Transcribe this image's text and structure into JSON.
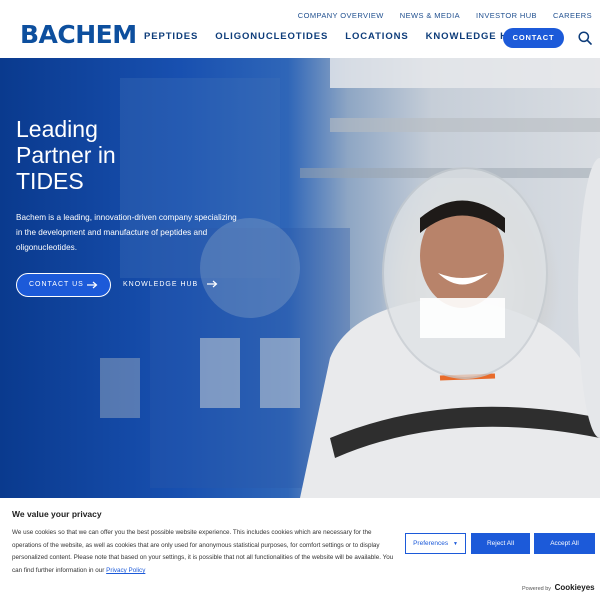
{
  "header": {
    "logo": "BACHEM",
    "top_links": [
      "COMPANY OVERVIEW",
      "NEWS & MEDIA",
      "INVESTOR HUB",
      "CAREERS"
    ],
    "main_nav": [
      "PEPTIDES",
      "OLIGONUCLEOTIDES",
      "LOCATIONS",
      "KNOWLEDGE HUB"
    ],
    "contact_label": "CONTACT"
  },
  "hero": {
    "title_line1": "Leading",
    "title_line2": "Partner in",
    "title_line3": "TIDES",
    "description": "Bachem is a leading, innovation-driven company specializing in the development and manufacture of peptides and oligonucleotides.",
    "contact_button": "CONTACT US",
    "knowledge_link": "KNOWLEDGE HUB"
  },
  "cookie": {
    "title": "We value your privacy",
    "text": "We use cookies so that we can offer you the best possible website experience. This includes cookies which are necessary for the operations of the website, as well as cookies that are only used for anonymous statistical purposes, for comfort settings or to display personalized content. Please note that based on your settings, it is possible that not all functionalities of the website will be available. You can find further information in our",
    "privacy_link": "Privacy Policy",
    "preferences": "Preferences",
    "reject": "Reject All",
    "accept": "Accept All",
    "powered_by": "Powered by",
    "powered_brand": "Cookieyes"
  },
  "colors": {
    "brand_blue": "#0d4f9e",
    "button_blue": "#1c5ad9",
    "nav_text": "#0d3c7a"
  }
}
